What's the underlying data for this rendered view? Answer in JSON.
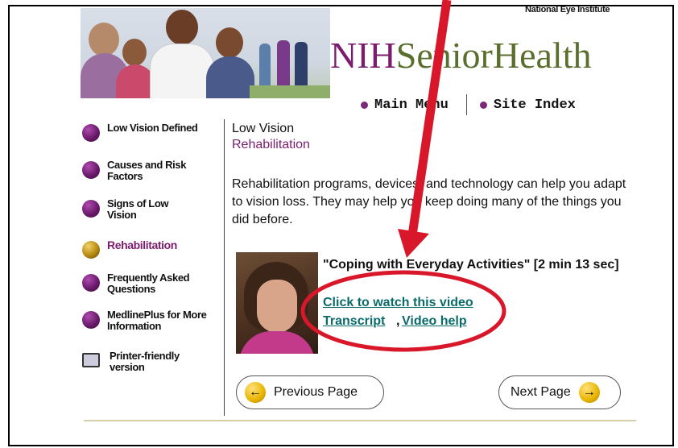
{
  "header": {
    "agency": "National Eye Institute",
    "brand_prefix": "NIH",
    "brand_rest": "SeniorHealth"
  },
  "topnav": {
    "main_menu": "Main Menu",
    "site_index": "Site Index"
  },
  "sidebar": {
    "items": [
      {
        "label": "Low Vision Defined",
        "active": false
      },
      {
        "label": "Causes and Risk Factors",
        "active": false
      },
      {
        "label": "Signs of Low Vision",
        "active": false
      },
      {
        "label": "Rehabilitation",
        "active": true
      },
      {
        "label": "Frequently Asked Questions",
        "active": false
      },
      {
        "label": "MedlinePlus for More Information",
        "active": false
      },
      {
        "label": "Printer-friendly version",
        "active": false
      }
    ]
  },
  "main": {
    "heading": "Low Vision",
    "subheading": "Rehabilitation",
    "intro": "Rehabilitation programs, devices, and technology can help you adapt to vision loss. They may help you keep doing many of the things you did before.",
    "video": {
      "title": "\"Coping with Everyday Activities\" [2 min 13 sec]",
      "watch_link": "Click to watch this video",
      "transcript_link": "Transcript",
      "separator": ",",
      "help_link": "Video help"
    }
  },
  "pager": {
    "previous": "Previous Page",
    "next": "Next Page"
  },
  "colors": {
    "brand_purple": "#7b1d6e",
    "brand_green": "#5a6e2e",
    "link_teal": "#0b6b6b",
    "annotation_red": "#d8182a"
  }
}
